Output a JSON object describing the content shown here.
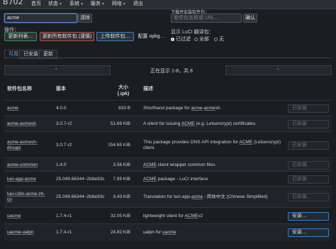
{
  "app": {
    "brand": "B702"
  },
  "nav": [
    {
      "label": "首页",
      "caret": false
    },
    {
      "label": "状态",
      "caret": true
    },
    {
      "label": "系统",
      "caret": true
    },
    {
      "label": "服务",
      "caret": true
    },
    {
      "label": "网络",
      "caret": true
    },
    {
      "label": "退出",
      "caret": false
    }
  ],
  "filter": {
    "value": "acme",
    "clear_label": "清除"
  },
  "url_install": {
    "label": "下载并安装软件包：",
    "placeholder": "软件包名称或 URL…",
    "confirm_label": "确认"
  },
  "actions": {
    "label": "操作：",
    "update_label": "更新列表…",
    "upgrade_label": "更新所有软件包 (谨慎)",
    "upload_label": "上传软件包…",
    "config_label": "配置 opkg…"
  },
  "luci_translation": {
    "label": "显示 LuCI 翻译包：",
    "options": [
      {
        "label": "已过滤",
        "selected": true
      },
      {
        "label": "全部",
        "selected": false
      },
      {
        "label": "无",
        "selected": false
      }
    ]
  },
  "tabs": [
    {
      "label": "可用",
      "active": true
    },
    {
      "label": "已安装",
      "active": false
    },
    {
      "label": "更新",
      "active": false
    }
  ],
  "pager": {
    "text": "正在显示 1-8，共 8",
    "prev_icon": "chevron-left-icon",
    "next_icon": "chevron-right-icon"
  },
  "table": {
    "headers": {
      "name": "软件包名称",
      "version": "版本",
      "size_line1": "大小",
      "size_line2": "(.ipk)",
      "description": "描述"
    },
    "rows": [
      {
        "name": "acme",
        "version": "4.0.0",
        "size": "833 B",
        "desc_parts": [
          {
            "t": "Shorthand package for "
          },
          {
            "t": "acme",
            "u": true
          },
          {
            "t": "-"
          },
          {
            "t": "acme",
            "u": true
          },
          {
            "t": "sh."
          }
        ],
        "action": "已安装",
        "installed": true
      },
      {
        "name": "acme-acmesh",
        "version": "3.0.7-r2",
        "size": "51.69 KiB",
        "desc_parts": [
          {
            "t": "A client for issuing "
          },
          {
            "t": "ACME",
            "u": true
          },
          {
            "t": " (e.g. Letsencrypt) certificates."
          }
        ],
        "action": "已安装",
        "installed": true
      },
      {
        "name": "acme-acmesh-dnsapi",
        "version": "3.0.7-r2",
        "size": "154.65 KiB",
        "desc_parts": [
          {
            "t": "This package provides DNS API integration for "
          },
          {
            "t": "ACME",
            "u": true
          },
          {
            "t": " (Letsencrypt)"
          }
        ],
        "desc_line2": "client.",
        "action": "已安装",
        "installed": true
      },
      {
        "name": "acme-common",
        "version": "1.4.0",
        "size": "3.56 KiB",
        "desc_parts": [
          {
            "t": "ACME",
            "u": true
          },
          {
            "t": " client wrapper common files."
          }
        ],
        "action": "已安装",
        "installed": true
      },
      {
        "name": "luci-app-acme",
        "version": "25.049.66344~2b8e93c",
        "size": "7.99 KiB",
        "desc_parts": [
          {
            "t": "ACME",
            "u": true
          },
          {
            "t": " package - LuCI interface"
          }
        ],
        "action": "已安装",
        "installed": true
      },
      {
        "name": "luci-i18n-acme-zh-cn",
        "version": "25.049.66344~2b8e93c",
        "size": "3.43 KiB",
        "desc_parts": [
          {
            "t": "Translation for luci-app-"
          },
          {
            "t": "acme",
            "u": true
          },
          {
            "t": " - 简体中文 (Chinese Simplified)"
          }
        ],
        "action": "已安装",
        "installed": true
      },
      {
        "name": "uacme",
        "version": "1.7.4-r1",
        "size": "32.05 KiB",
        "desc_parts": [
          {
            "t": "lightweight client for "
          },
          {
            "t": "ACME",
            "u": true
          },
          {
            "t": "v2"
          }
        ],
        "action": "安装…",
        "installed": false
      },
      {
        "name": "uacme-ualpn",
        "version": "1.7.4-r1",
        "size": "24.82 KiB",
        "desc_parts": [
          {
            "t": "ualpn for "
          },
          {
            "t": "uacme",
            "u": true
          }
        ],
        "action": "安装…",
        "installed": false
      }
    ]
  },
  "colors": {
    "background": "#1b1d20",
    "accent_blue": "#3c7fbf",
    "danger_red": "#b4504c",
    "positive_green": "#3d8a63",
    "active_tab": "#63a4e6"
  }
}
